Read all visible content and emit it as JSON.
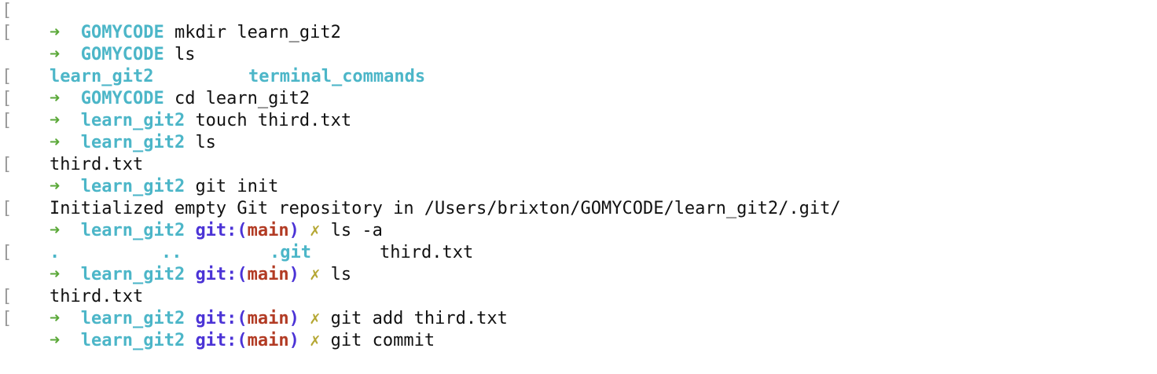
{
  "prompt": {
    "arrow": "➜",
    "git_label": "git:(",
    "git_close": ")",
    "dirty_mark": "✗",
    "colors": {
      "arrow": "#5aa838",
      "dir": "#4cb6c8",
      "git": "#4b33d6",
      "branch": "#b23b24",
      "dirty": "#b5a733"
    }
  },
  "lines": [
    {
      "type": "prompt",
      "dir": "GOMYCODE",
      "cmd": "mkdir learn_git2"
    },
    {
      "type": "prompt",
      "dir": "GOMYCODE",
      "cmd": "ls"
    },
    {
      "type": "ls-output",
      "items": [
        "learn_git2",
        "terminal_commands"
      ]
    },
    {
      "type": "prompt",
      "dir": "GOMYCODE",
      "cmd": "cd learn_git2"
    },
    {
      "type": "prompt",
      "dir": "learn_git2",
      "cmd": "touch third.txt"
    },
    {
      "type": "prompt",
      "dir": "learn_git2",
      "cmd": "ls"
    },
    {
      "type": "output",
      "text": "third.txt"
    },
    {
      "type": "prompt",
      "dir": "learn_git2",
      "cmd": "git init"
    },
    {
      "type": "output",
      "text": "Initialized empty Git repository in /Users/brixton/GOMYCODE/learn_git2/.git/"
    },
    {
      "type": "git-prompt",
      "dir": "learn_git2",
      "branch": "main",
      "cmd": "ls -a"
    },
    {
      "type": "ls-a-output",
      "items": [
        ".",
        "..",
        ".git",
        "third.txt"
      ]
    },
    {
      "type": "git-prompt",
      "dir": "learn_git2",
      "branch": "main",
      "cmd": "ls"
    },
    {
      "type": "output",
      "text": "third.txt"
    },
    {
      "type": "git-prompt",
      "dir": "learn_git2",
      "branch": "main",
      "cmd": "git add third.txt"
    },
    {
      "type": "git-prompt",
      "dir": "learn_git2",
      "branch": "main",
      "cmd": "git commit"
    }
  ]
}
